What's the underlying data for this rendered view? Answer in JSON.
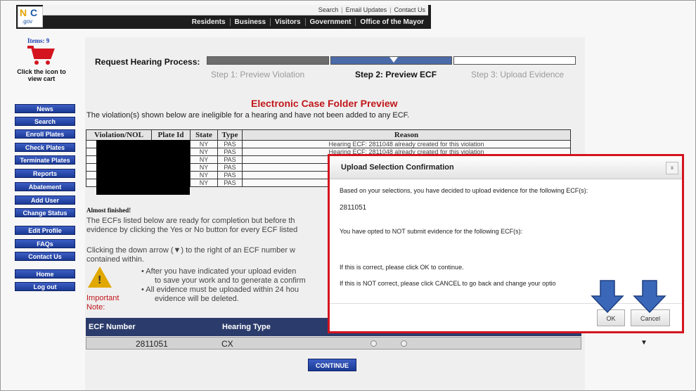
{
  "header": {
    "logo_text": [
      "NYC",
      ".gov"
    ],
    "top_links": [
      "Search",
      "Email Updates",
      "Contact Us"
    ],
    "main_nav": [
      "Residents",
      "Business",
      "Visitors",
      "Government",
      "Office of the Mayor"
    ]
  },
  "sidebar": {
    "items_label": "Items: 9",
    "cart_label": "Click the icon to view cart",
    "buttons": [
      "News",
      "Search",
      "Enroll Plates",
      "Check Plates",
      "Terminate Plates",
      "Reports",
      "Abatement",
      "Add User",
      "Change Status",
      "Edit Profile",
      "FAQs",
      "Contact Us",
      "Home",
      "Log out"
    ]
  },
  "process": {
    "label": "Request Hearing Process:",
    "steps": [
      "Step 1: Preview Violation",
      "Step 2: Preview ECF",
      "Step 3: Upload Evidence"
    ],
    "current_step": 2
  },
  "main": {
    "title": "Electronic Case Folder Preview",
    "ineligible_text": "The violation(s) shown below are ineligible for a hearing and have not been added to any ECF.",
    "violation_headers": [
      "Violation/NOL",
      "Plate Id",
      "State",
      "Type",
      "Reason"
    ],
    "violation_rows": [
      {
        "state": "NY",
        "type": "PAS",
        "reason": "Hearing ECF: 2811048 already created for this violation"
      },
      {
        "state": "NY",
        "type": "PAS",
        "reason": "Hearing ECF: 2811048 already created for this violation"
      },
      {
        "state": "NY",
        "type": "PAS",
        "reason": ""
      },
      {
        "state": "NY",
        "type": "PAS",
        "reason": ""
      },
      {
        "state": "NY",
        "type": "PAS",
        "reason": ""
      },
      {
        "state": "NY",
        "type": "PAS",
        "reason": ""
      }
    ],
    "almost_finished": "Almost finished!",
    "para1_line1": "The ECFs listed below are ready for completion but before th",
    "para1_line2": "evidence by clicking the Yes or No button for every ECF listed",
    "para2_line1": "Clicking the down arrow (▼) to the right of an ECF number w",
    "para2_line2": "contained within.",
    "bullet1_line1": "• After you have indicated your upload eviden",
    "bullet1_line2": "to save your work and to generate a confirm",
    "bullet2_line1": "• All evidence must be uploaded within 24 hou",
    "bullet2_line2": "evidence will be deleted.",
    "important_note": "Important Note:",
    "ecf_headers": [
      "ECF Number",
      "Hearing Type"
    ],
    "ecf_row": {
      "number": "2811051",
      "type": "CX"
    },
    "continue_label": "CONTINUE"
  },
  "modal": {
    "title": "Upload Selection Confirmation",
    "close_label": "x",
    "line1": "Based on your selections, you have decided to upload evidence for the following ECF(s):",
    "ecf_upload": "2811051",
    "line2": "You have opted to NOT submit evidence for the following ECF(s):",
    "line3": "If this is correct, please click OK to continue.",
    "line4": "If this is NOT correct, please click CANCEL to go back and change your optio",
    "ok_label": "OK",
    "cancel_label": "Cancel"
  },
  "colors": {
    "accent": "#d4141f",
    "nav_blue": "#2b3b6b",
    "arrow_blue": "#3a67b8"
  }
}
